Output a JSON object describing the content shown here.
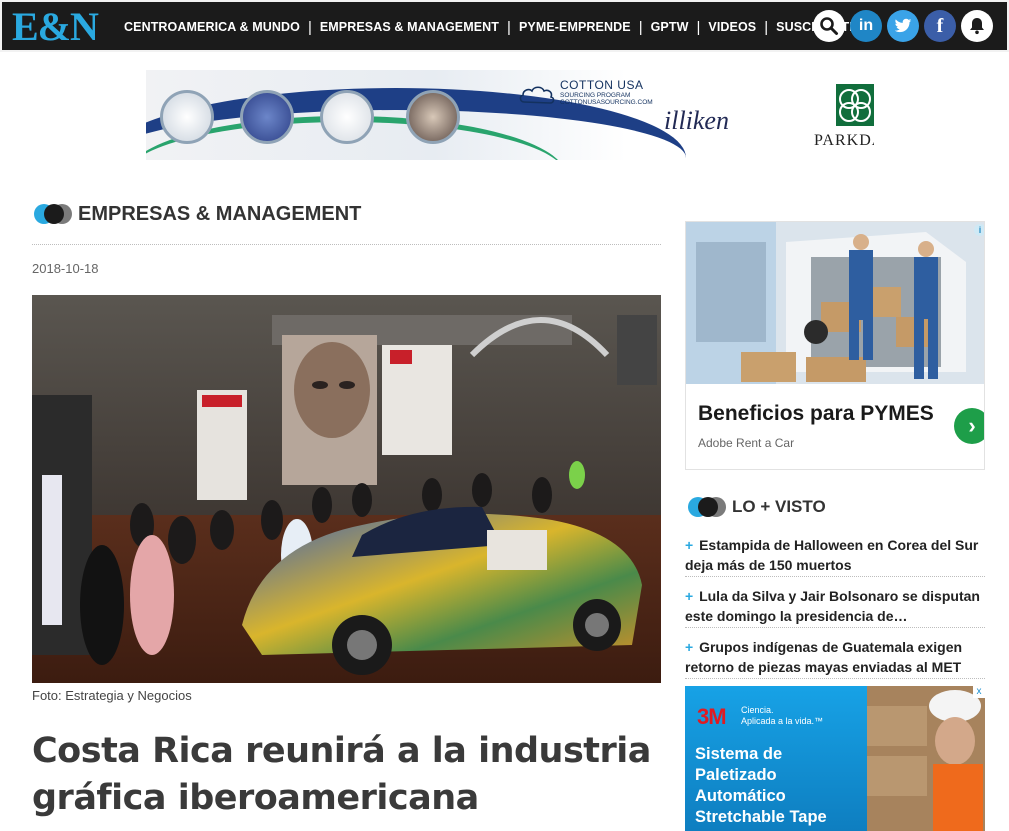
{
  "header": {
    "logo": "E&N",
    "nav": [
      {
        "label": "CENTROAMERICA & MUNDO"
      },
      {
        "label": "EMPRESAS & MANAGEMENT"
      },
      {
        "label": "PYME-EMPRENDE"
      },
      {
        "label": "GPTW"
      },
      {
        "label": "VIDEOS"
      },
      {
        "label": "SUSCRÍBETE"
      }
    ],
    "separator": "|",
    "icons": [
      "search-icon",
      "linkedin-icon",
      "twitter-icon",
      "facebook-icon",
      "bell-icon"
    ],
    "linkedin_glyph": "in",
    "facebook_glyph": "f"
  },
  "banner_ad": {
    "cotton_title": "COTTON USA",
    "cotton_sub1": "SOURCING PROGRAM",
    "cotton_sub2": "COTTONUSASOURCING.COM",
    "brand2": "illiken",
    "brand3": "PARKDA"
  },
  "article": {
    "section": "EMPRESAS & MANAGEMENT",
    "date": "2018-10-18",
    "caption": "Foto: Estrategia y Negocios",
    "headline": "Costa Rica reunirá a la industria gráfica iberoamericana"
  },
  "sidebar": {
    "ad1": {
      "title": "Beneficios para PYMES",
      "sponsor": "Adobe Rent a Car",
      "arrow": "›",
      "info": "i"
    },
    "most_viewed": {
      "title": "LO + VISTO",
      "plus": "+",
      "items": [
        {
          "text": "Estampida de Halloween en Corea del Sur deja más de 150 muertos"
        },
        {
          "text": "Lula da Silva y Jair Bolsonaro se disputan este domingo la presidencia de…"
        },
        {
          "text": "Grupos indígenas de Guatemala exigen retorno de piezas mayas enviadas al MET"
        }
      ]
    },
    "ad2": {
      "logo": "3M",
      "tagline1": "Ciencia.",
      "tagline2": "Aplicada a la vida.™",
      "text": "Sistema de Paletizado Automático Stretchable Tape",
      "close": "x"
    }
  },
  "colors": {
    "brand_blue": "#2aa9e0",
    "topbar": "#1b1b1b",
    "ad_green": "#1e9e49",
    "threem_red": "#e01b22"
  }
}
